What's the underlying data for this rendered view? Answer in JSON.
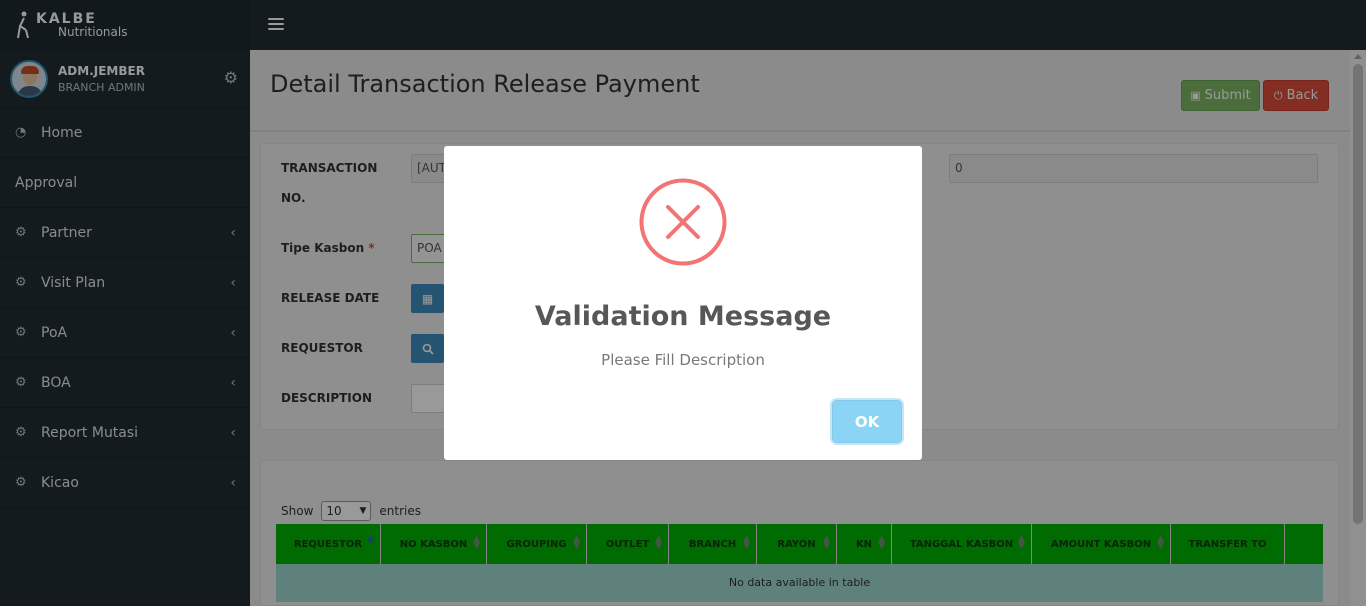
{
  "brand": {
    "line1": "KALBE",
    "line2": "Nutritionals"
  },
  "user": {
    "name": "ADM.JEMBER",
    "role": "BRANCH ADMIN"
  },
  "sidebar": {
    "items": [
      {
        "label": "Home",
        "icon": "dashboard-icon",
        "has_chevron": false
      },
      {
        "label": "Approval",
        "icon": "",
        "has_chevron": false
      },
      {
        "label": "Partner",
        "icon": "gear-icon",
        "has_chevron": true
      },
      {
        "label": "Visit Plan",
        "icon": "gear-icon",
        "has_chevron": true
      },
      {
        "label": "PoA",
        "icon": "gear-icon",
        "has_chevron": true
      },
      {
        "label": "BOA",
        "icon": "gear-icon",
        "has_chevron": true
      },
      {
        "label": "Report Mutasi",
        "icon": "gear-icon",
        "has_chevron": true
      },
      {
        "label": "Kicao",
        "icon": "gear-icon",
        "has_chevron": true
      }
    ]
  },
  "page": {
    "title": "Detail Transaction Release Payment",
    "submit_label": "Submit",
    "back_label": "Back"
  },
  "form": {
    "transaction_no_label_1": "TRANSACTION",
    "transaction_no_label_2": "NO.",
    "transaction_no_value": "[AUT",
    "right_value": "0",
    "tipe_kasbon_label": "Tipe Kasbon",
    "tipe_kasbon_value": "POA",
    "release_date_label": "RELEASE DATE",
    "requestor_label": "REQUESTOR",
    "description_label": "DESCRIPTION"
  },
  "table": {
    "show_label": "Show",
    "page_size": "10",
    "entries_label": "entries",
    "columns": [
      "REQUESTOR",
      "NO KASBON",
      "GROUPING",
      "OUTLET",
      "BRANCH",
      "RAYON",
      "KN",
      "TANGGAL KASBON",
      "AMOUNT KASBON",
      "TRANSFER TO",
      ""
    ],
    "empty_text": "No data available in table"
  },
  "modal": {
    "title": "Validation Message",
    "text": "Please Fill Description",
    "ok_label": "OK",
    "icon": "error-x-icon",
    "icon_color": "#f27474"
  },
  "colors": {
    "sidebar": "#222d32",
    "table_header": "#00b300",
    "submit": "#7eb663",
    "back": "#dd4b39",
    "ok": "#8cd4f5"
  }
}
